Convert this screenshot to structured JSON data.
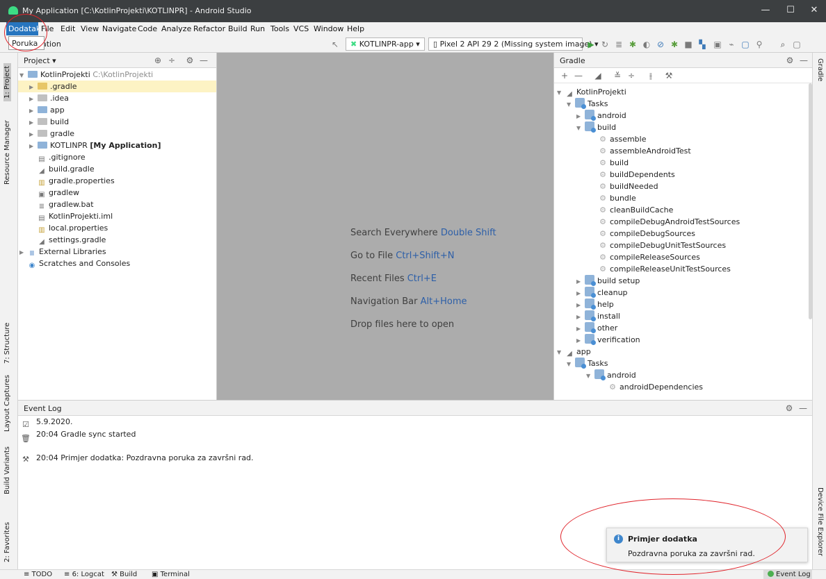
{
  "window": {
    "title": "My Application [C:\\KotlinProjekti\\KOTLINPR] - Android Studio",
    "minimize": "—",
    "maximize": "☐",
    "close": "✕"
  },
  "menu": {
    "items": [
      "Dodatak",
      "File",
      "Edit",
      "View",
      "Navigate",
      "Code",
      "Analyze",
      "Refactor",
      "Build",
      "Run",
      "Tools",
      "VCS",
      "Window",
      "Help"
    ],
    "popup_item": "Poruka"
  },
  "toolbar": {
    "breadcrumb": "ation",
    "run_config": "KOTLINPR-app ▾",
    "device": "Pixel 2 API 29 2 (Missing system image) ▾"
  },
  "left_strip": {
    "tabs": [
      "1: Project",
      "Resource Manager",
      "7: Structure",
      "Layout Captures",
      "Build Variants",
      "2: Favorites"
    ]
  },
  "right_strip": {
    "tabs": [
      "Gradle",
      "Device File Explorer"
    ]
  },
  "project": {
    "header": "Project ▾",
    "root_name": "KotlinProjekti",
    "root_path": "C:\\KotlinProjekti",
    "items": [
      ".gradle",
      ".idea",
      "app",
      "build",
      "gradle",
      "KOTLINPR",
      ".gitignore",
      "build.gradle",
      "gradle.properties",
      "gradlew",
      "gradlew.bat",
      "KotlinProjekti.iml",
      "local.properties",
      "settings.gradle",
      "External Libraries",
      "Scratches and Consoles"
    ],
    "module_suffix": "[My Application]"
  },
  "editor": {
    "hints": [
      {
        "label": "Search Everywhere",
        "key": "Double Shift"
      },
      {
        "label": "Go to File",
        "key": "Ctrl+Shift+N"
      },
      {
        "label": "Recent Files",
        "key": "Ctrl+E"
      },
      {
        "label": "Navigation Bar",
        "key": "Alt+Home"
      },
      {
        "label": "Drop files here to open",
        "key": ""
      }
    ]
  },
  "gradle": {
    "header": "Gradle",
    "root": "KotlinProjekti",
    "tasks": "Tasks",
    "groups_top": [
      "android",
      "build"
    ],
    "build_tasks": [
      "assemble",
      "assembleAndroidTest",
      "build",
      "buildDependents",
      "buildNeeded",
      "bundle",
      "cleanBuildCache",
      "compileDebugAndroidTestSources",
      "compileDebugSources",
      "compileDebugUnitTestSources",
      "compileReleaseSources",
      "compileReleaseUnitTestSources"
    ],
    "groups_bottom": [
      "build setup",
      "cleanup",
      "help",
      "install",
      "other",
      "verification"
    ],
    "app": "app",
    "app_tasks": "Tasks",
    "app_android": "android",
    "app_task": "androidDependencies"
  },
  "event_log": {
    "header": "Event Log",
    "date": "5.9.2020.",
    "entries": [
      {
        "time": "20:04",
        "text": "Gradle sync started"
      },
      {
        "time": "20:04",
        "text": "Primjer dodatka: Pozdravna poruka za završni rad."
      }
    ]
  },
  "notification": {
    "title": "Primjer dodatka",
    "body": "Pozdravna poruka za završni rad."
  },
  "statusbar": {
    "tabs": [
      "TODO",
      "6: Logcat",
      "Build",
      "Terminal"
    ],
    "event_log_button": "Event Log"
  },
  "colors": {
    "accent": "#2675bf",
    "annotation": "#e0242b",
    "selection": "#fdf3c4"
  }
}
